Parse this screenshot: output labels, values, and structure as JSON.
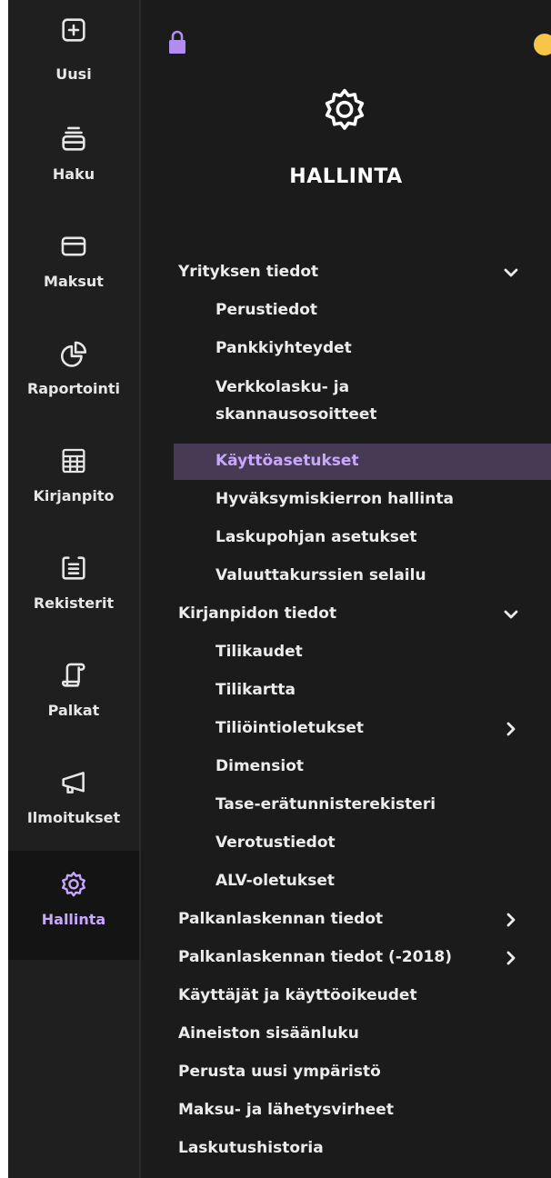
{
  "rail": {
    "items": [
      {
        "label": "Uusi",
        "icon": "plus-square-icon"
      },
      {
        "label": "Haku",
        "icon": "search-stack-icon"
      },
      {
        "label": "Maksut",
        "icon": "card-icon"
      },
      {
        "label": "Raportointi",
        "icon": "pie-chart-icon"
      },
      {
        "label": "Kirjanpito",
        "icon": "calculator-icon"
      },
      {
        "label": "Rekisterit",
        "icon": "register-icon"
      },
      {
        "label": "Palkat",
        "icon": "scroll-icon"
      },
      {
        "label": "Ilmoitukset",
        "icon": "megaphone-icon"
      },
      {
        "label": "Hallinta",
        "icon": "gear-icon",
        "active": true
      }
    ]
  },
  "panel": {
    "title": "HALLINTA",
    "icon": "gear-icon",
    "status_color": "#f7c548",
    "accent_color": "#c9a7ff"
  },
  "menu": {
    "sections": [
      {
        "label": "Yrityksen tiedot",
        "chevron": "down",
        "items": [
          "Perustiedot",
          "Pankkiyhteydet",
          "Verkkolasku- ja skannausosoitteet",
          "Käyttöasetukset",
          "Hyväksymiskierron hallinta",
          "Laskupohjan asetukset",
          "Valuuttakurssien selailu"
        ],
        "active_item": "Käyttöasetukset"
      },
      {
        "label": "Kirjanpidon tiedot",
        "chevron": "down",
        "items": [
          "Tilikaudet",
          "Tilikartta",
          "Tiliöintioletukset",
          "Dimensiot",
          "Tase-erätunnisterekisteri",
          "Verotustiedot",
          "ALV-oletukset"
        ],
        "item_chevrons": {
          "Tiliöintioletukset": "right"
        }
      },
      {
        "label": "Palkanlaskennan tiedot",
        "chevron": "right"
      },
      {
        "label": "Palkanlaskennan tiedot (-2018)",
        "chevron": "right"
      },
      {
        "label": "Käyttäjät ja käyttöoikeudet"
      },
      {
        "label": "Aineiston sisäänluku"
      },
      {
        "label": "Perusta uusi ympäristö"
      },
      {
        "label": "Maksu- ja lähetysvirheet"
      },
      {
        "label": "Laskutushistoria"
      }
    ]
  }
}
